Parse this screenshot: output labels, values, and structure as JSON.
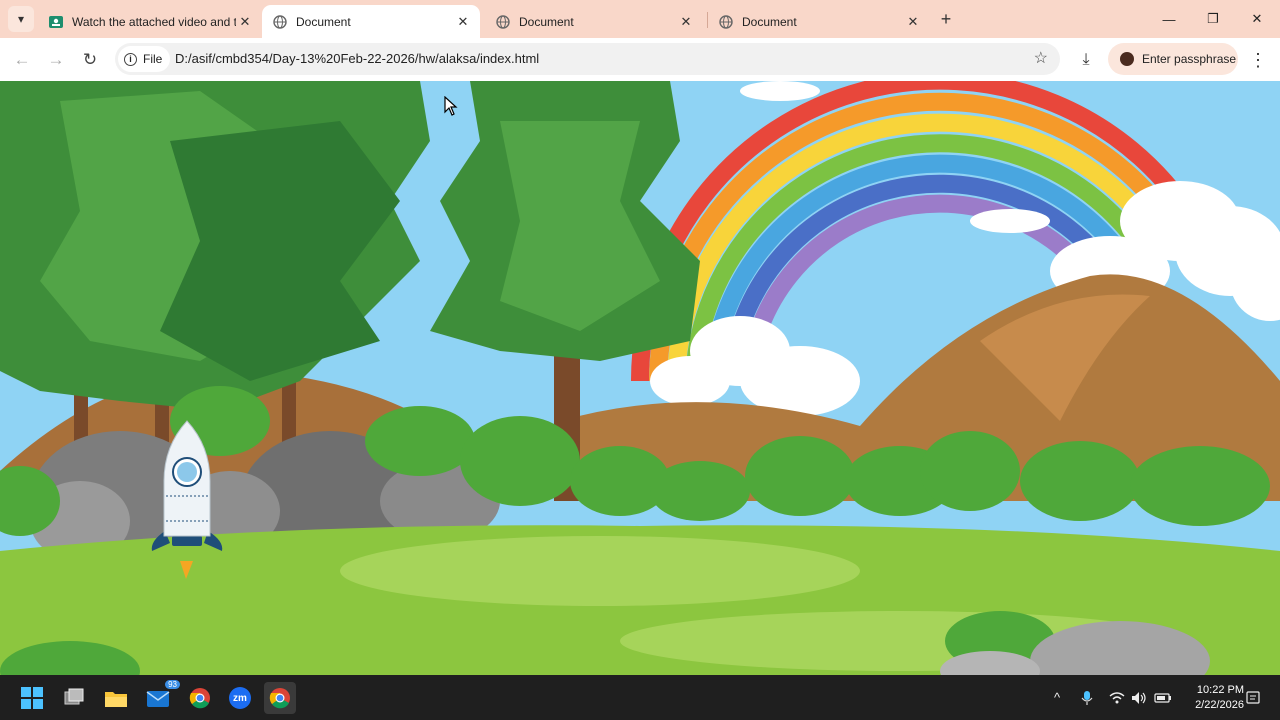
{
  "tabs": [
    {
      "title": "Watch the attached video and t",
      "active": false
    },
    {
      "title": "Document",
      "active": true
    },
    {
      "title": "Document",
      "active": false
    },
    {
      "title": "Document",
      "active": false
    }
  ],
  "close_glyph": "✕",
  "new_tab_glyph": "+",
  "window_controls": {
    "minimize": "—",
    "restore": "❐",
    "close": "✕"
  },
  "toolbar": {
    "back": "←",
    "forward": "→",
    "reload": "↻",
    "chip_label": "File",
    "url": "D:/asif/cmbd354/Day-13%20Feb-22-2026/hw/alaksa/index.html",
    "bookmark": "☆",
    "download": "⤓",
    "profile_label": "Enter passphrase",
    "menu": "⋮"
  },
  "taskbar": {
    "mail_badge": "93",
    "zoom_label": "zm",
    "tray_chevron": "^",
    "time": "10:22 PM",
    "date": "2/22/2026"
  },
  "colors": {
    "tabstrip": "#f9d7c9",
    "sky": "#7fcbf0",
    "grass": "#8cc63f",
    "taskbar": "#1f1f1f"
  }
}
